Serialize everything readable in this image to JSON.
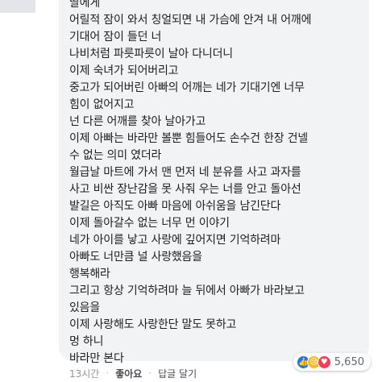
{
  "comment": {
    "lines": [
      "딸에게",
      "어릴적 잠이 와서 칭얼되면 내 가슴에 안겨 내 어깨에",
      "기대어 잠이 들던 너",
      "나비처럼 파릇파릇이 날아 다니더니",
      "이제 숙녀가 되어버리고",
      "중고가 되어버린 아빠의 어깨는 네가 기대기엔 너무",
      "힘이 없어지고",
      "넌 다른 어깨를 찾아 날아가고",
      "이제 아빠는 바라만 볼뿐 힘들어도 손수건 한장 건넬",
      "수 없는 의미 였더라",
      "월급날 마트에 가서 맨 먼저 네 분유를 사고 과자를",
      "사고 비싼 장난감을 못 사줘 우는 너를 안고 돌아선",
      "발길은 아직도 아빠 마음에 아쉬움을 남긴단다",
      "이제 돌아갈수 없는 너무 먼 이야기",
      "네가 아이를 낳고 사랑에 깊어지면 기억하려마",
      "아빠도 너만큼 널 사랑했음을",
      "행복해라",
      "그리고 항상 기억하려마 늘 뒤에서 아빠가 바라보고",
      "있음을",
      "이제 사랑해도 사랑한단 말도 못하고",
      "멍 하니",
      "바라만 본다"
    ]
  },
  "reactions": {
    "icons": [
      "like-icon",
      "sad-icon",
      "love-icon"
    ],
    "like_glyph": "👍",
    "sad_glyph": "😢",
    "love_glyph": "♥",
    "count": "5,650"
  },
  "footer": {
    "time": "13시간",
    "like_label": "좋아요",
    "reply_label": "답글 달기"
  },
  "colors": {
    "bubble": "#f2f3f5",
    "text": "#1c1e21",
    "meta": "#90949c",
    "like": "#1877f2",
    "sad": "#f7b928",
    "love": "#f33e58"
  }
}
